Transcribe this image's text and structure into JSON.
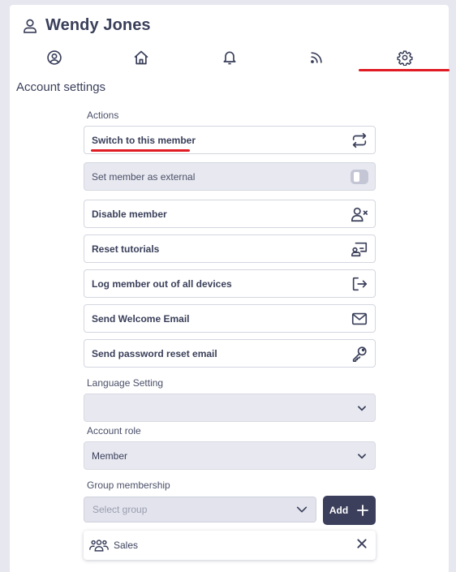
{
  "member": {
    "name": "Wendy Jones",
    "icon": "user-icon"
  },
  "tabs": [
    {
      "icon": "user-circle-icon",
      "label": "Profile"
    },
    {
      "icon": "home-icon",
      "label": "Home"
    },
    {
      "icon": "bell-icon",
      "label": "Notifications"
    },
    {
      "icon": "rss-feed-icon",
      "label": "Feed"
    },
    {
      "icon": "gear-icon",
      "label": "Settings",
      "active": true
    }
  ],
  "section_title": "Account settings",
  "actions_label": "Actions",
  "actions": [
    {
      "label": "Switch to this member",
      "icon": "switch-icon",
      "active": true
    },
    {
      "label": "Set member as external",
      "icon": "toggle-icon",
      "disabled": true
    },
    {
      "label": "Disable member",
      "icon": "user-x-icon"
    },
    {
      "label": "Reset tutorials",
      "icon": "presentation-icon"
    },
    {
      "label": "Log member out of all devices",
      "icon": "logout-icon"
    },
    {
      "label": "Send Welcome Email",
      "icon": "mail-icon"
    },
    {
      "label": "Send password reset email",
      "icon": "key-icon"
    }
  ],
  "language": {
    "label": "Language Setting",
    "value": ""
  },
  "role": {
    "label": "Account role",
    "value": "Member"
  },
  "groups": {
    "label": "Group membership",
    "placeholder": "Select group",
    "add_label": "Add",
    "items": [
      {
        "name": "Sales"
      }
    ]
  },
  "colors": {
    "accent": "#e01b24",
    "primary": "#3b3f5c",
    "text": "#3a3f5a"
  }
}
